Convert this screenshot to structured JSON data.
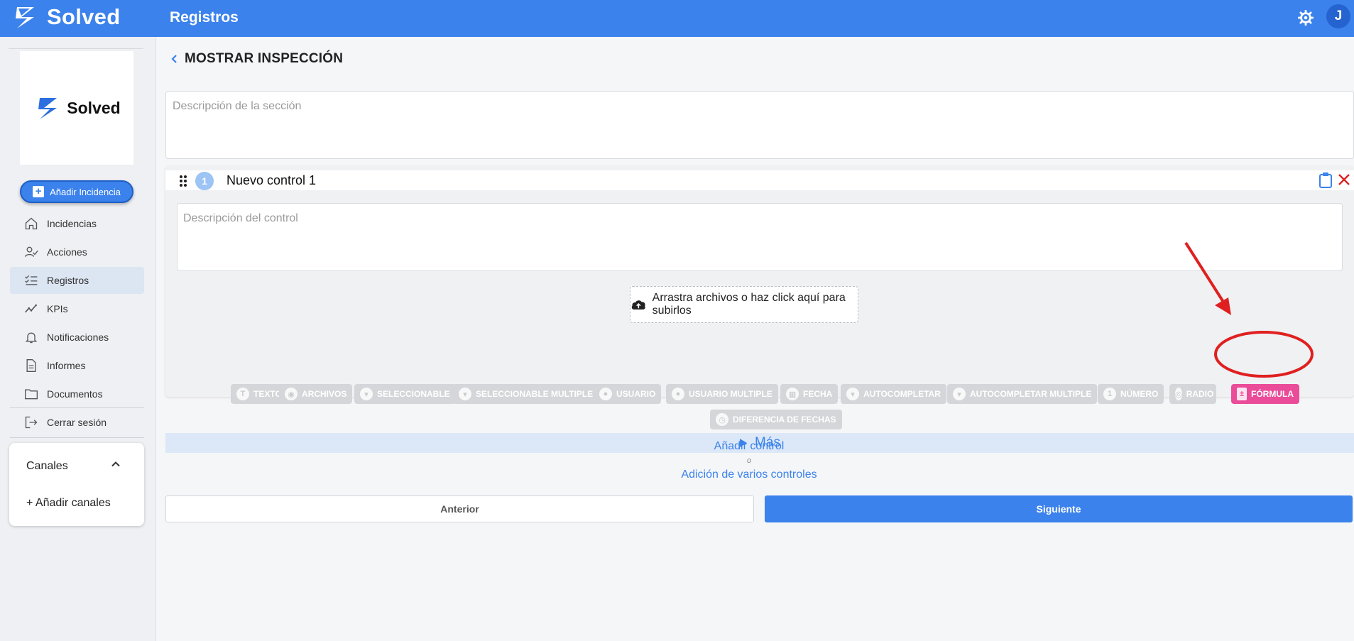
{
  "header": {
    "app_name": "Solved",
    "page_title": "Registros",
    "avatar_initial": "J"
  },
  "sidebar": {
    "brand_name": "Solved",
    "add_button_label": "Añadir Incidencia",
    "items": [
      {
        "label": "Incidencias",
        "icon": "home-icon"
      },
      {
        "label": "Acciones",
        "icon": "user-check-icon"
      },
      {
        "label": "Registros",
        "icon": "checklist-icon",
        "active": true
      },
      {
        "label": "KPIs",
        "icon": "trend-icon"
      },
      {
        "label": "Notificaciones",
        "icon": "bell-icon"
      },
      {
        "label": "Informes",
        "icon": "document-icon"
      },
      {
        "label": "Documentos",
        "icon": "folder-icon"
      }
    ],
    "logout_label": "Cerrar sesión",
    "channels": {
      "title": "Canales",
      "add_label": "+ Añadir canales"
    }
  },
  "main": {
    "back_title": "MOSTRAR INSPECCIÓN",
    "section_description_placeholder": "Descripción de la sección",
    "control": {
      "number": "1",
      "title": "Nuevo control 1",
      "description_placeholder": "Descripción del control",
      "upload_label": "Arrastra archivos o haz click aquí para subirlos",
      "types": [
        "TEXTO",
        "ARCHIVOS",
        "SELECCIONABLE",
        "SELECCIONABLE MULTIPLE",
        "USUARIO",
        "USUARIO MULTIPLE",
        "FECHA",
        "AUTOCOMPLETAR",
        "AUTOCOMPLETAR MULTIPLE",
        "NÚMERO",
        "RADIO",
        "FÓRMULA",
        "DIFERENCIA DE FECHAS"
      ],
      "selected_type": "FÓRMULA",
      "more_label": "Más"
    },
    "add_control_label": "Añadir control",
    "or_label": "o",
    "add_multiple_label": "Adición de varios controles",
    "prev_label": "Anterior",
    "next_label": "Siguiente"
  },
  "colors": {
    "primary": "#3b82ec",
    "formula_chip": "#ea4c9a",
    "annotation": "#e02020"
  }
}
